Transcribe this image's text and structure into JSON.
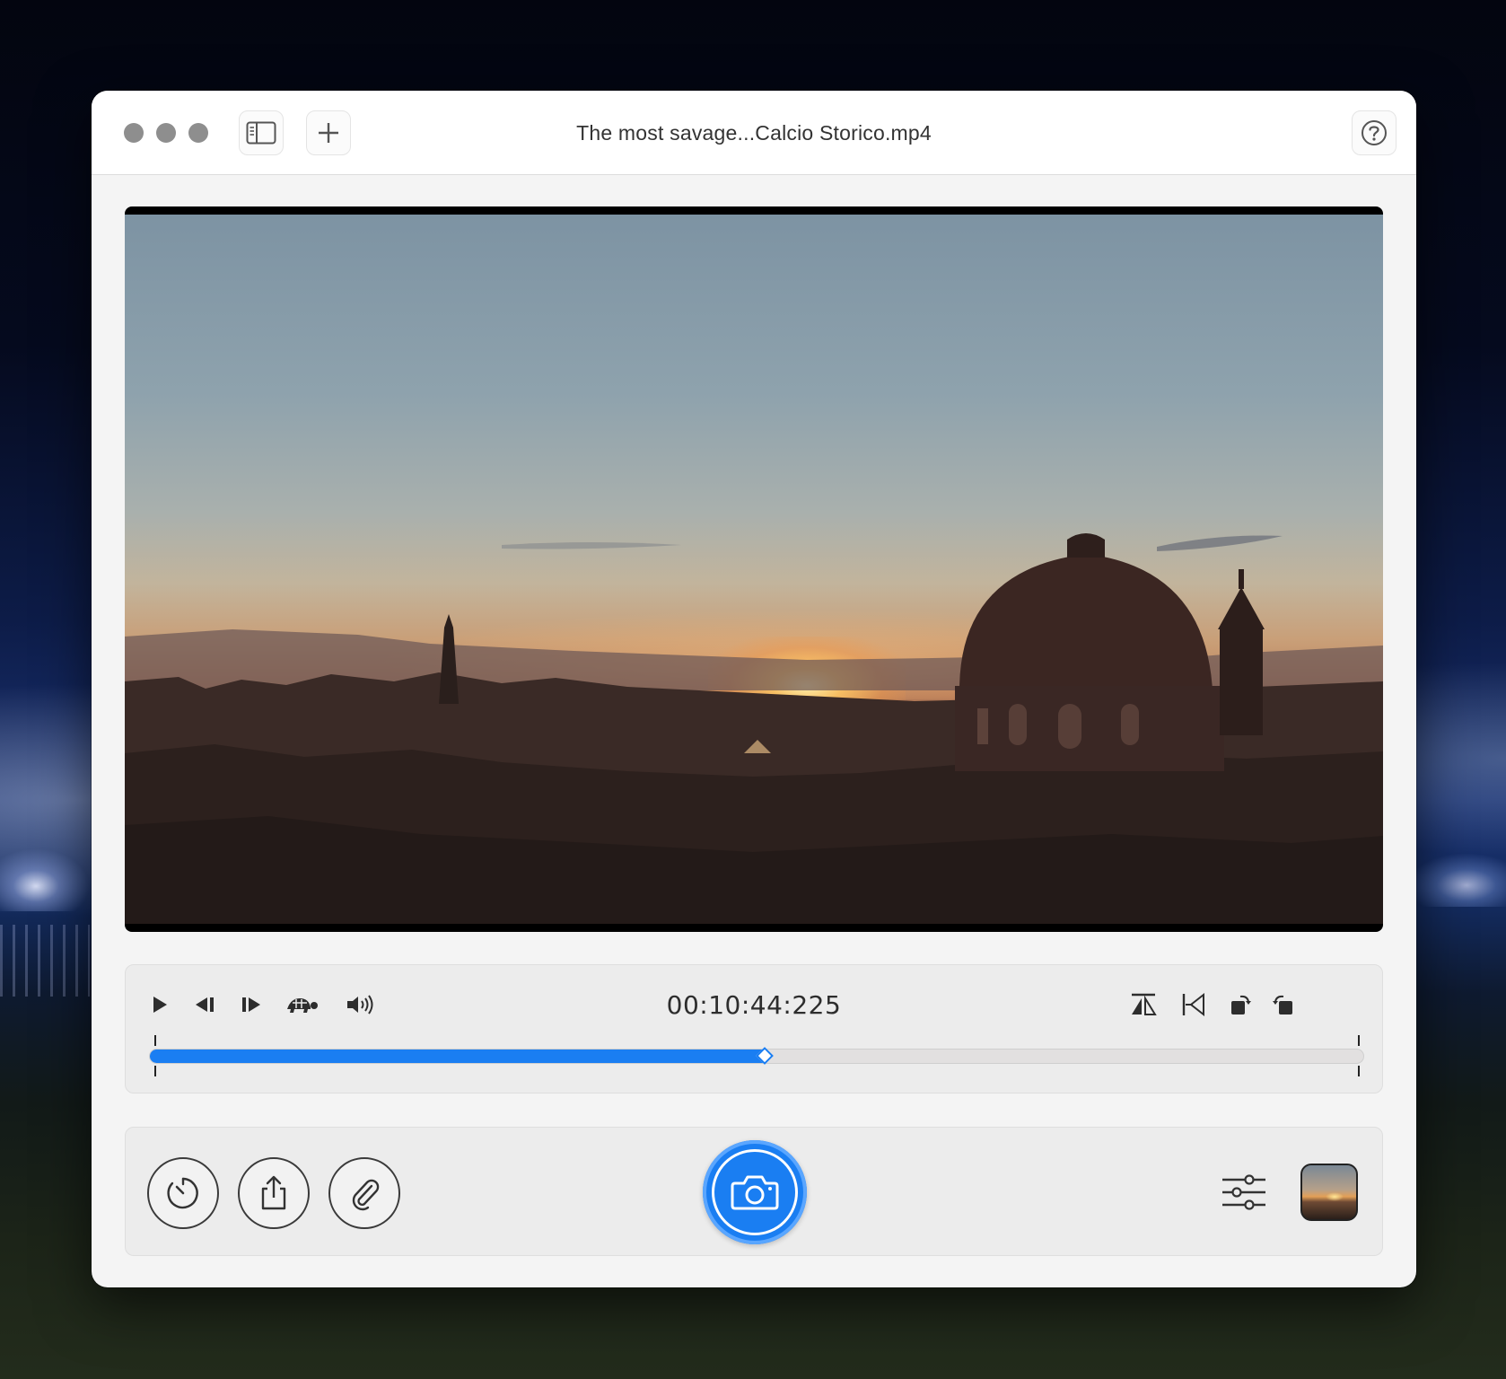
{
  "window": {
    "title": "The most savage...Calcio Storico.mp4"
  },
  "toolbar": {
    "icons": [
      "sidebar-toggle-icon",
      "plus-icon",
      "help-icon"
    ]
  },
  "player": {
    "timecode": "00:10:44:225",
    "progress_fraction": 0.507,
    "left_icons": [
      "play-icon",
      "step-back-icon",
      "step-forward-icon",
      "turtle-slow-icon",
      "volume-icon"
    ],
    "right_icons": [
      "flip-horizontal-icon",
      "trim-start-icon",
      "rotate-left-icon",
      "rotate-right-icon"
    ]
  },
  "actions": {
    "left": [
      "timer-icon",
      "share-icon",
      "paperclip-icon"
    ],
    "center": "camera-icon",
    "right": [
      "sliders-icon",
      "thumbnail-preview"
    ]
  },
  "colors": {
    "accent": "#1a7ef2",
    "track_bg": "#e2e0e0",
    "window_bg": "#f4f4f4"
  }
}
